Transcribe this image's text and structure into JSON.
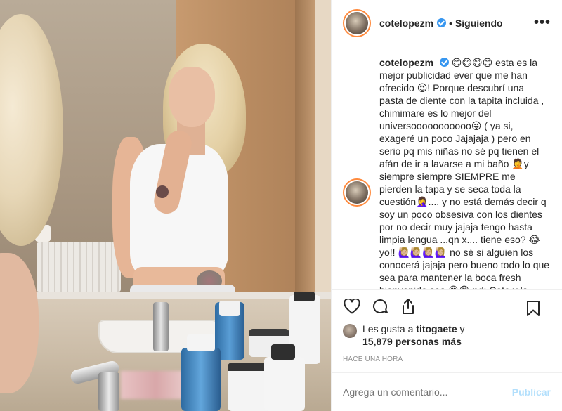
{
  "header": {
    "username": "cotelopezm",
    "follow_status": "Siguiendo",
    "separator": "•",
    "more": "•••"
  },
  "caption": {
    "username": "cotelopezm",
    "text": "😄😄😄😄 esta es la mejor publicidad ever que me han ofrecido 😍! Porque descubrí una pasta de diente con la tapita incluida , chimimare es lo mejor del universooooooooooo😜 ( ya si, exageré un poco Jajajaja ) pero en serio pq mis niñas no sé pq tienen el afán de ir a lavarse a mi baño 🤦y siempre siempre SIEMPRE me pierden la tapa y se seca toda la cuestión🤦‍♀️.... y no está demás decir q soy un poco obsesiva con los dientes por no decir muy jajaja tengo hasta limpia lengua ...qn x.... tiene eso? 😂 yo!! 🙋🏼‍♀️🙋🏼‍♀️🙋🏼‍♀️🙋🏼‍♀️ no sé si alguien los conocerá jajaja pero bueno todo lo que sea para mantener la boca fresh bienvenido sea 😍😂 pd: Cote y la pasta de dientes se venden por"
  },
  "likes": {
    "prefix": "Les gusta a ",
    "user": "titogaete",
    "middle": " y",
    "count": "15,879 personas más"
  },
  "timestamp": "HACE UNA HORA",
  "comment_box": {
    "placeholder": "Agrega un comentario...",
    "publish": "Publicar"
  },
  "icons": {
    "like": "heart-icon",
    "comment": "comment-icon",
    "share": "share-icon",
    "save": "bookmark-icon",
    "verified": "verified-icon"
  },
  "colors": {
    "verified": "#3897f0",
    "publish_disabled": "#b2dffc",
    "story_ring": "#ff8a3d"
  }
}
